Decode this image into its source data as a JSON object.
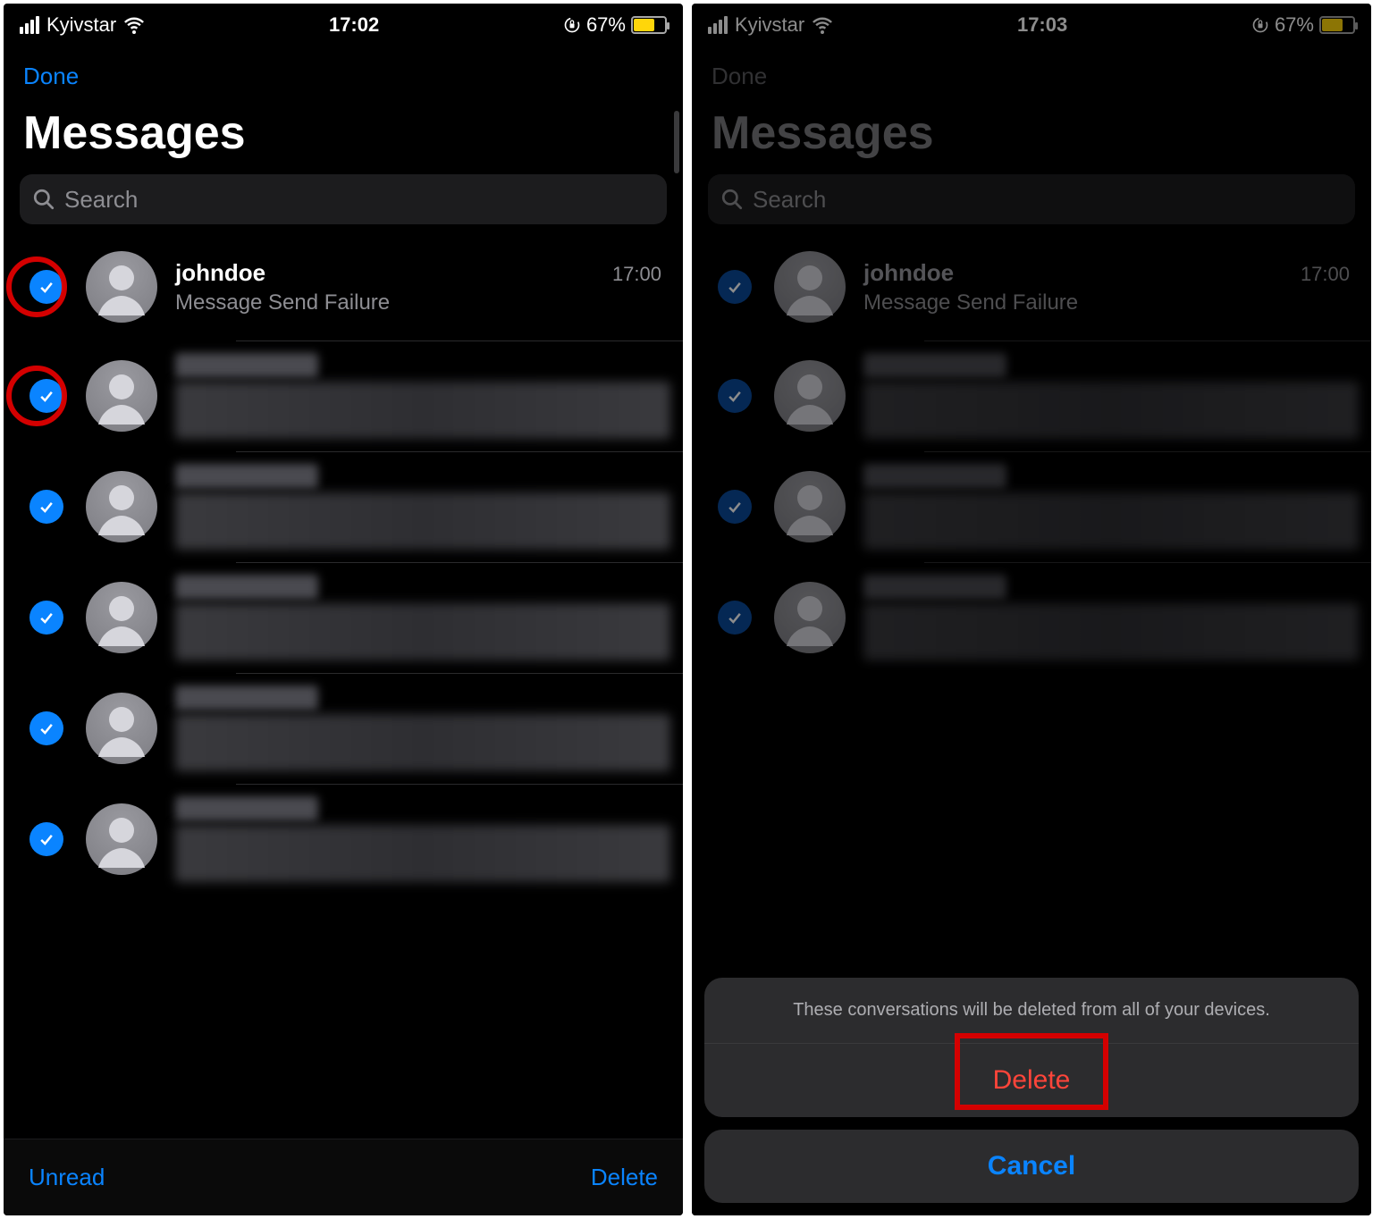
{
  "left": {
    "status": {
      "carrier": "Kyivstar",
      "time": "17:02",
      "battery": "67%"
    },
    "nav": {
      "done": "Done"
    },
    "title": "Messages",
    "search": {
      "placeholder": "Search"
    },
    "conversations": [
      {
        "name": "johndoe",
        "preview": "Message Send Failure",
        "time": "17:00",
        "selected": true,
        "annot_ring": true,
        "blurred": false
      },
      {
        "selected": true,
        "annot_ring": true,
        "blurred": true
      },
      {
        "selected": true,
        "annot_ring": false,
        "blurred": true
      },
      {
        "selected": true,
        "annot_ring": false,
        "blurred": true
      },
      {
        "selected": true,
        "annot_ring": false,
        "blurred": true
      },
      {
        "selected": true,
        "annot_ring": false,
        "blurred": true
      }
    ],
    "toolbar": {
      "unread": "Unread",
      "delete": "Delete"
    }
  },
  "right": {
    "status": {
      "carrier": "Kyivstar",
      "time": "17:03",
      "battery": "67%"
    },
    "nav": {
      "done": "Done"
    },
    "title": "Messages",
    "search": {
      "placeholder": "Search"
    },
    "conversations": [
      {
        "name": "johndoe",
        "preview": "Message Send Failure",
        "time": "17:00",
        "selected": true,
        "blurred": false
      },
      {
        "selected": true,
        "blurred": true
      },
      {
        "selected": true,
        "blurred": true
      },
      {
        "selected": true,
        "blurred": true
      }
    ],
    "sheet": {
      "message": "These conversations will be deleted from all of your devices.",
      "delete": "Delete",
      "cancel": "Cancel"
    }
  }
}
